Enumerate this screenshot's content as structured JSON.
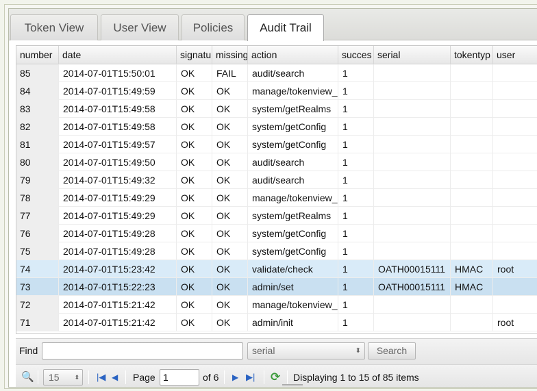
{
  "tabs": [
    {
      "label": "Token View"
    },
    {
      "label": "User View"
    },
    {
      "label": "Policies"
    },
    {
      "label": "Audit Trail"
    }
  ],
  "columns": [
    "number",
    "date",
    "signatu",
    "missing",
    "action",
    "succes",
    "serial",
    "tokentyp",
    "user"
  ],
  "rows": [
    {
      "number": "85",
      "date": "2014-07-01T15:50:01",
      "signature": "OK",
      "missing": "FAIL",
      "action": "audit/search",
      "success": "1",
      "serial": "",
      "tokentype": "",
      "user": ""
    },
    {
      "number": "84",
      "date": "2014-07-01T15:49:59",
      "signature": "OK",
      "missing": "OK",
      "action": "manage/tokenview_",
      "success": "1",
      "serial": "",
      "tokentype": "",
      "user": ""
    },
    {
      "number": "83",
      "date": "2014-07-01T15:49:58",
      "signature": "OK",
      "missing": "OK",
      "action": "system/getRealms",
      "success": "1",
      "serial": "",
      "tokentype": "",
      "user": ""
    },
    {
      "number": "82",
      "date": "2014-07-01T15:49:58",
      "signature": "OK",
      "missing": "OK",
      "action": "system/getConfig",
      "success": "1",
      "serial": "",
      "tokentype": "",
      "user": ""
    },
    {
      "number": "81",
      "date": "2014-07-01T15:49:57",
      "signature": "OK",
      "missing": "OK",
      "action": "system/getConfig",
      "success": "1",
      "serial": "",
      "tokentype": "",
      "user": ""
    },
    {
      "number": "80",
      "date": "2014-07-01T15:49:50",
      "signature": "OK",
      "missing": "OK",
      "action": "audit/search",
      "success": "1",
      "serial": "",
      "tokentype": "",
      "user": ""
    },
    {
      "number": "79",
      "date": "2014-07-01T15:49:32",
      "signature": "OK",
      "missing": "OK",
      "action": "audit/search",
      "success": "1",
      "serial": "",
      "tokentype": "",
      "user": ""
    },
    {
      "number": "78",
      "date": "2014-07-01T15:49:29",
      "signature": "OK",
      "missing": "OK",
      "action": "manage/tokenview_",
      "success": "1",
      "serial": "",
      "tokentype": "",
      "user": ""
    },
    {
      "number": "77",
      "date": "2014-07-01T15:49:29",
      "signature": "OK",
      "missing": "OK",
      "action": "system/getRealms",
      "success": "1",
      "serial": "",
      "tokentype": "",
      "user": ""
    },
    {
      "number": "76",
      "date": "2014-07-01T15:49:28",
      "signature": "OK",
      "missing": "OK",
      "action": "system/getConfig",
      "success": "1",
      "serial": "",
      "tokentype": "",
      "user": ""
    },
    {
      "number": "75",
      "date": "2014-07-01T15:49:28",
      "signature": "OK",
      "missing": "OK",
      "action": "system/getConfig",
      "success": "1",
      "serial": "",
      "tokentype": "",
      "user": ""
    },
    {
      "number": "74",
      "date": "2014-07-01T15:23:42",
      "signature": "OK",
      "missing": "OK",
      "action": "validate/check",
      "success": "1",
      "serial": "OATH00015111",
      "tokentype": "HMAC",
      "user": "root"
    },
    {
      "number": "73",
      "date": "2014-07-01T15:22:23",
      "signature": "OK",
      "missing": "OK",
      "action": "admin/set",
      "success": "1",
      "serial": "OATH00015111",
      "tokentype": "HMAC",
      "user": ""
    },
    {
      "number": "72",
      "date": "2014-07-01T15:21:42",
      "signature": "OK",
      "missing": "OK",
      "action": "manage/tokenview_",
      "success": "1",
      "serial": "",
      "tokentype": "",
      "user": ""
    },
    {
      "number": "71",
      "date": "2014-07-01T15:21:42",
      "signature": "OK",
      "missing": "OK",
      "action": "admin/init",
      "success": "1",
      "serial": "",
      "tokentype": "",
      "user": "root"
    }
  ],
  "find": {
    "label": "Find",
    "value": "",
    "field_selected": "serial",
    "search_label": "Search"
  },
  "pager": {
    "rows_per_page": "15",
    "page_label": "Page",
    "page_value": "1",
    "of_label": "of 6",
    "status": "Displaying 1 to 15 of 85 items"
  },
  "icons": {
    "find": "magnifier-icon",
    "first": "first-page-icon",
    "prev": "prev-page-icon",
    "next": "next-page-icon",
    "last": "last-page-icon",
    "refresh": "refresh-icon"
  },
  "colors": {
    "selected_row_light": "#d9ebf8",
    "selected_row": "#c9e0f1",
    "pager_icon": "#2a63c2",
    "refresh_icon": "#3a9a3a"
  }
}
